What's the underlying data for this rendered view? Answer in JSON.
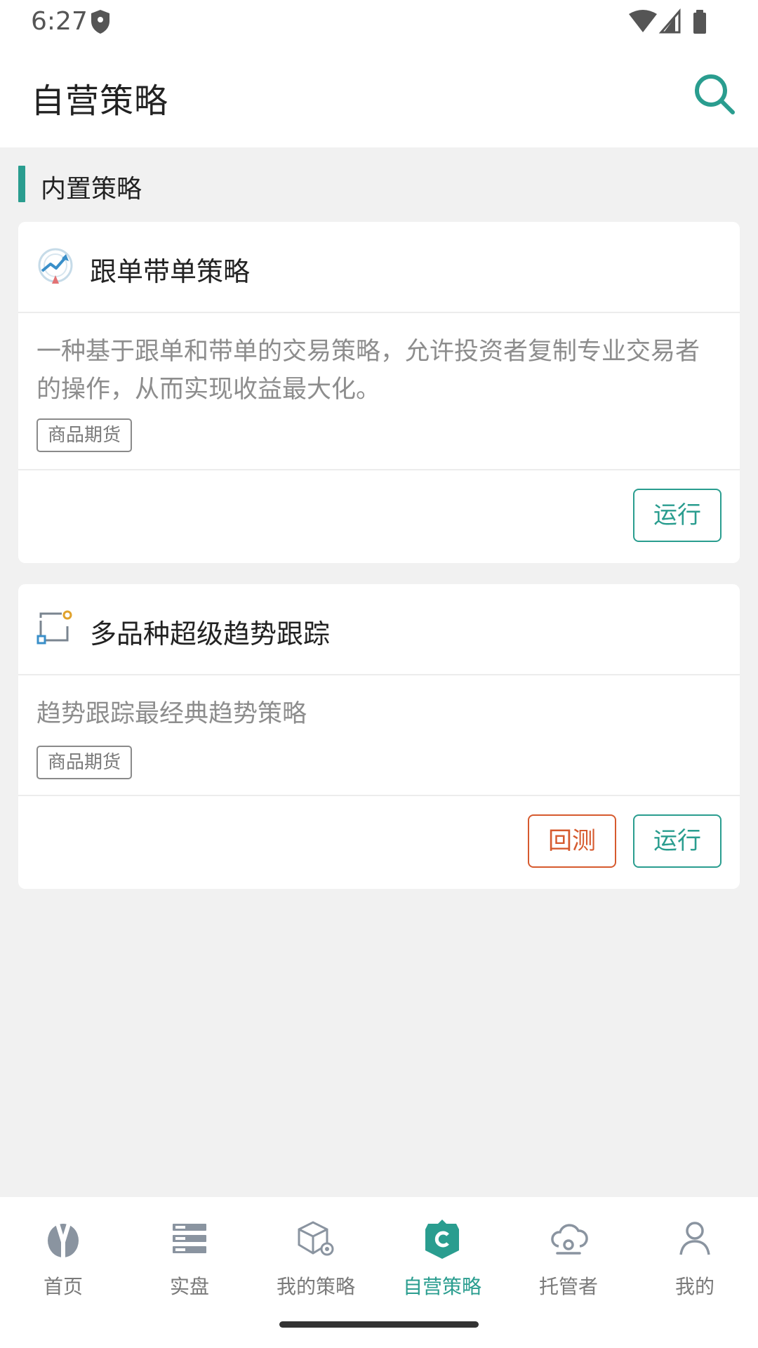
{
  "status_bar": {
    "time": "6:27"
  },
  "app_bar": {
    "title": "自营策略",
    "search_icon": "search-icon"
  },
  "section": {
    "title": "内置策略"
  },
  "strategies": [
    {
      "title": "跟单带单策略",
      "icon": "trend-chart-icon",
      "description": "一种基于跟单和带单的交易策略，允许投资者复制专业交易者的操作，从而实现收益最大化。",
      "tag": "商品期货",
      "run_label": "运行"
    },
    {
      "title": "多品种超级趋势跟踪",
      "icon": "frame-dot-icon",
      "description": "趋势跟踪最经典趋势策略",
      "tag": "商品期货",
      "backtest_label": "回测",
      "run_label": "运行"
    }
  ],
  "bottom_nav": [
    {
      "label": "首页",
      "icon": "home-y-icon"
    },
    {
      "label": "实盘",
      "icon": "server-icon"
    },
    {
      "label": "我的策略",
      "icon": "box-gear-icon"
    },
    {
      "label": "自营策略",
      "icon": "shield-c-icon",
      "active": true
    },
    {
      "label": "托管者",
      "icon": "cloud-icon"
    },
    {
      "label": "我的",
      "icon": "user-icon"
    }
  ],
  "colors": {
    "accent": "#2a9d8f",
    "backtest": "#d65a2e",
    "background": "#f1f1f1"
  }
}
